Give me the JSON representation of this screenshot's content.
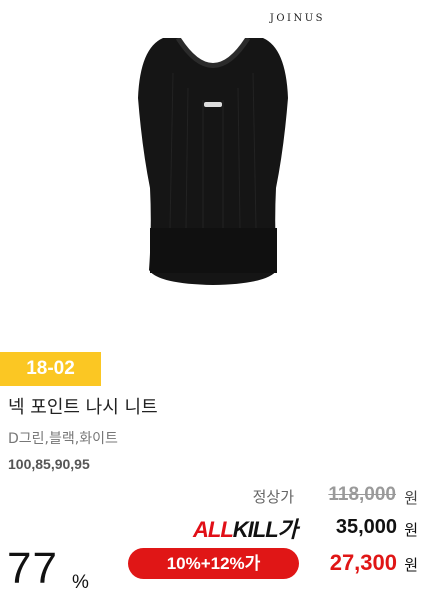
{
  "brand": "JOINUS",
  "badge": "18-02",
  "product": {
    "title": "넥 포인트 나시 니트",
    "colors": "D그린,블랙,화이트",
    "sizes": "100,85,90,95"
  },
  "price": {
    "regular_label": "정상가",
    "regular": "118,000",
    "allkill_logo_a": "ALL",
    "allkill_logo_b": "KILL가",
    "allkill": "35,000",
    "coupon": "10%+12%가",
    "final": "27,300",
    "currency": "원"
  },
  "discount": {
    "value": "77",
    "unit": "%"
  },
  "colors": {
    "badge": "#fbc723",
    "accent_red": "#e01616"
  }
}
